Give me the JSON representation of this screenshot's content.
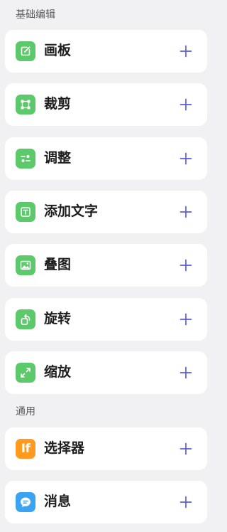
{
  "sections": [
    {
      "title": "基础编辑",
      "items": [
        {
          "label": "画板",
          "icon": "drawing-board-icon"
        },
        {
          "label": "裁剪",
          "icon": "crop-icon"
        },
        {
          "label": "调整",
          "icon": "adjust-sliders-icon"
        },
        {
          "label": "添加文字",
          "icon": "add-text-icon"
        },
        {
          "label": "叠图",
          "icon": "overlay-image-icon"
        },
        {
          "label": "旋转",
          "icon": "rotate-icon"
        },
        {
          "label": "缩放",
          "icon": "scale-icon"
        }
      ]
    },
    {
      "title": "通用",
      "items": [
        {
          "label": "选择器",
          "icon": "selector-icon",
          "icon_text": "If"
        },
        {
          "label": "消息",
          "icon": "message-icon"
        }
      ]
    }
  ],
  "add_button_icon": "plus-icon",
  "colors": {
    "background": "#f1f1f4",
    "card": "#ffffff",
    "edit_icon_bg": "#5cc96b",
    "selector_icon_bg": "#ff9a1f",
    "message_icon_bg": "#3aa4f3",
    "add_icon": "#5b5ed8",
    "section_title": "#5a5a5a",
    "label": "#1e1e1e"
  }
}
